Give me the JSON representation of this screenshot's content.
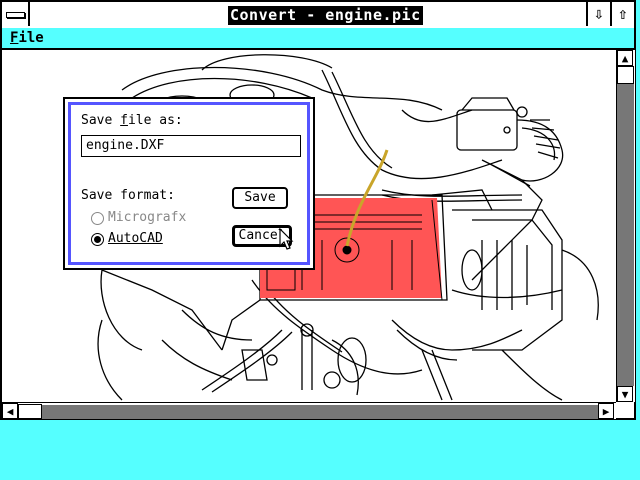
{
  "window": {
    "title": "Convert - engine.pic",
    "control_buttons": [
      "⇩",
      "⇧"
    ]
  },
  "menubar": {
    "items": [
      {
        "label": "File",
        "mnemonic": "F"
      }
    ]
  },
  "dialog": {
    "filename_label": "Save file as:",
    "filename_label_mnemonic": "f",
    "filename_value": "engine.DXF",
    "format_label": "Save format:",
    "options": [
      {
        "label": "Micrografx",
        "selected": false,
        "enabled": false
      },
      {
        "label": "AutoCAD",
        "selected": true,
        "enabled": true
      }
    ],
    "save_label": "Save",
    "cancel_label": "Cancel"
  },
  "colors": {
    "desktop": "#55FFFF",
    "menubar": "#55FFFF",
    "dialog_border": "#5555FF",
    "highlight": "#FF5555",
    "scroll_track": "#777777"
  }
}
